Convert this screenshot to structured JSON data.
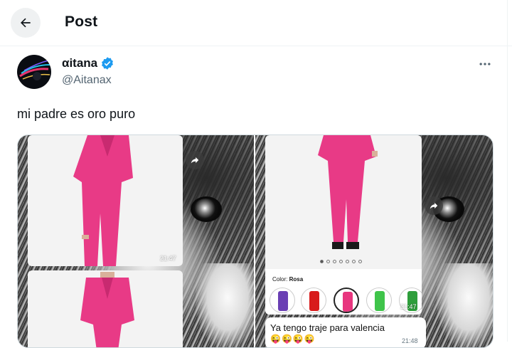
{
  "header": {
    "title": "Post",
    "back_icon": "arrow-left-icon"
  },
  "author": {
    "display_name": "αitana",
    "handle": "@Aitanax",
    "verified": true,
    "verified_color": "#1d9bf0",
    "avatar_icon": "profile-avatar"
  },
  "more_icon": "more-horizontal-icon",
  "tweet": {
    "text": "mi padre es oro puro"
  },
  "media": {
    "left": {
      "timestamp_top": "21:47"
    },
    "right": {
      "color_label_prefix": "Color:",
      "color_label_value": "Rosa",
      "swatch_colors": [
        "#6a3fb4",
        "#d81b1b",
        "#e8367f",
        "#3fc44a",
        "#2e9e3b"
      ],
      "selected_swatch": 2,
      "carousel_dots": 7,
      "active_dot": 0,
      "timestamp_top": "21:47",
      "message_text": "Ya tengo traje para valencia",
      "message_emojis": "😜😜😜😜",
      "message_time": "21:48"
    },
    "suit_color": "#e83a86"
  }
}
